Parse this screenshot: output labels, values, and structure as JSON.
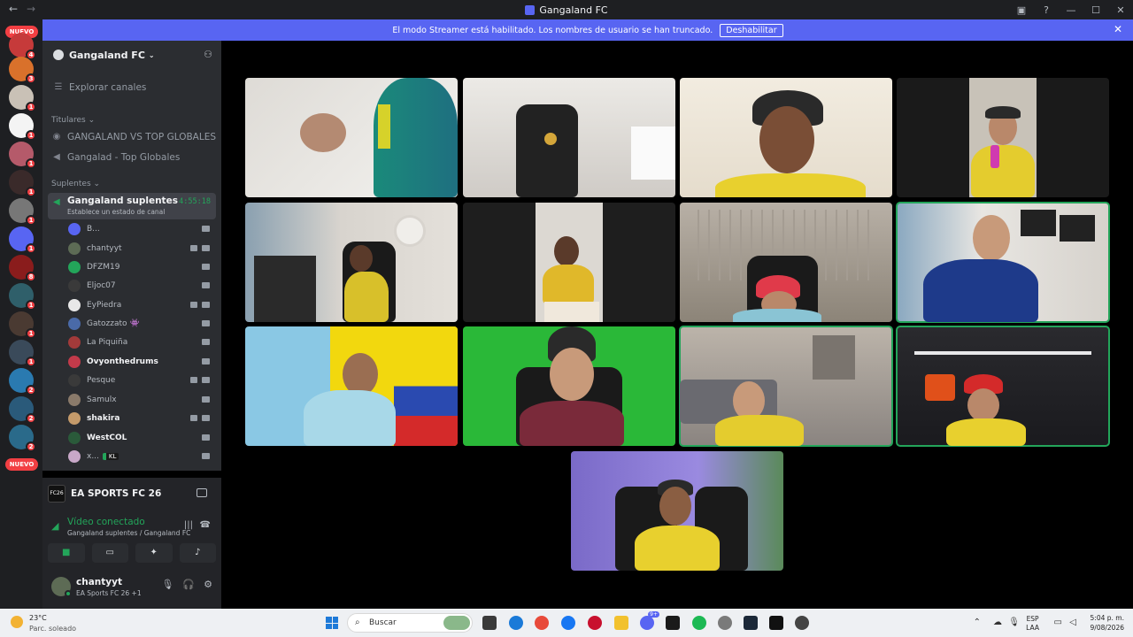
{
  "window": {
    "title": "Gangaland FC"
  },
  "banner": {
    "text": "El modo Streamer está habilitado. Los nombres de usuario se han truncado.",
    "button": "Deshabilitar"
  },
  "server_list": {
    "new_label": "NUEVO",
    "badges": [
      "4",
      "3",
      "1",
      "1",
      "1",
      "1",
      "1",
      "1",
      "8",
      "1",
      "1",
      "1",
      "2",
      "2",
      "2"
    ]
  },
  "guild": {
    "name": "Gangaland FC",
    "browse": "Explorar canales",
    "categories": [
      {
        "name": "Titulares",
        "channels": [
          "GANGALAND VS TOP GLOBALES",
          "Gangalad - Top Globales"
        ]
      },
      {
        "name": "Suplentes"
      }
    ],
    "active_channel": {
      "name": "Gangaland suplentes",
      "status": "Establece un estado de canal",
      "timer": "4:55:18"
    },
    "voice_users": [
      "B...",
      "chantyyt",
      "DFZM19",
      "Eljoc07",
      "EyPiedra",
      "Gatozzato",
      "La Piquiña",
      "Ovyonthedrums",
      "Pesque",
      "Samulx",
      "shakira",
      "WestCOL",
      "x..."
    ],
    "voice_user_tags": {
      "Gatozzato": "👾",
      "x...": "KL"
    }
  },
  "panel": {
    "game": "EA SPORTS FC 26",
    "game_icon_text": "FC26",
    "voice_status": "Vídeo conectado",
    "voice_location": "Gangaland suplentes / Gangaland FC",
    "username": "chantyyt",
    "activity": "EA Sports FC 26 +1"
  },
  "taskbar": {
    "temp": "23°C",
    "weather": "Parc. soleado",
    "search_placeholder": "Buscar",
    "lang1": "ESP",
    "lang2": "LAA",
    "time": "5:04 p. m.",
    "date": "9/08/2026",
    "notif_count": "9+"
  },
  "colors": {
    "accent": "#5865f2",
    "speaking": "#23a55a",
    "alert": "#f23f43",
    "sidebar": "#2b2d31"
  }
}
